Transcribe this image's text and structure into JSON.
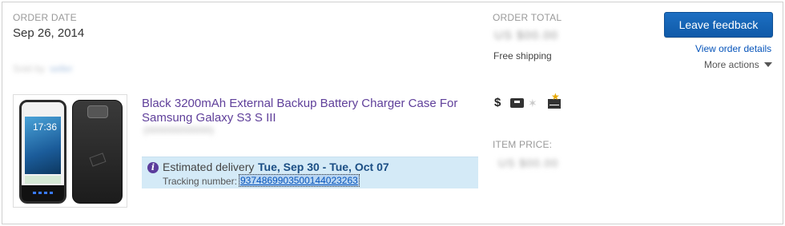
{
  "order": {
    "date_label": "ORDER DATE",
    "date_value": "Sep 26, 2014",
    "sold_by_text": "Sold by",
    "seller_name": "seller",
    "total_label": "ORDER TOTAL",
    "total_value": "US $00.00",
    "shipping_text": "Free shipping"
  },
  "actions": {
    "leave_feedback": "Leave feedback",
    "view_order_details": "View order details",
    "more_actions": "More actions"
  },
  "item": {
    "title": "Black 3200mAh External Backup Battery Charger Case For Samsung Galaxy S3 S III",
    "item_number": "(000000000000)",
    "price_label": "ITEM PRICE:",
    "price_value": "US $00.00",
    "phone_time": "17:36"
  },
  "delivery": {
    "estimated_label": "Estimated delivery",
    "estimated_dates": "Tue, Sep 30 - Tue, Oct 07",
    "tracking_label": "Tracking number:",
    "tracking_number": "9374869903500144023263"
  },
  "status_icons": [
    "dollar-icon",
    "shipping-box-icon",
    "star-icon",
    "feedback-mail-icon"
  ],
  "colors": {
    "button_blue": "#0f5aa8",
    "link_blue": "#0654ba",
    "title_purple": "#5f3f9a",
    "delivery_bg": "#d4eaf7",
    "delivery_date": "#1b4e84"
  }
}
